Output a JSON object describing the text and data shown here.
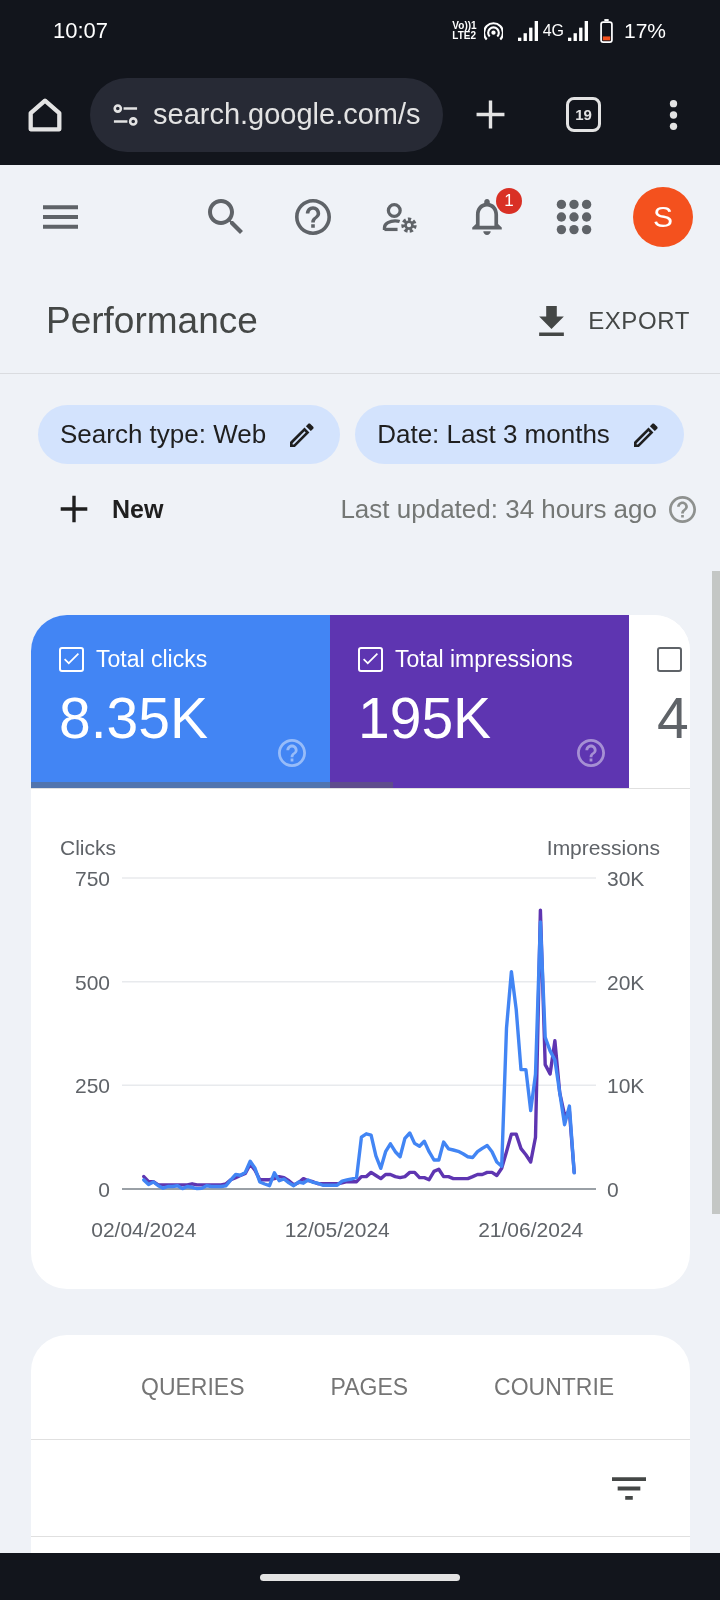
{
  "status_bar": {
    "time": "10:07",
    "volte_top": "Vo))1",
    "volte_bottom": "LTE2",
    "network": "4G",
    "battery": "17%"
  },
  "browser": {
    "url": "search.google.com/s",
    "tab_count": "19"
  },
  "header": {
    "notification_count": "1",
    "avatar_letter": "S"
  },
  "page_title": "Performance",
  "export_button": "EXPORT",
  "filters": [
    {
      "label": "Search type: Web"
    },
    {
      "label": "Date: Last 3 months"
    }
  ],
  "new_button": "New",
  "last_updated": "Last updated: 34 hours ago",
  "metrics": [
    {
      "label": "Total clicks",
      "value": "8.35K",
      "checked": true,
      "color": "#4285f4",
      "has_help": true
    },
    {
      "label": "Total impressions",
      "value": "195K",
      "checked": true,
      "color": "#5e35b1",
      "has_help": true
    },
    {
      "value": "4",
      "checked": false
    }
  ],
  "chart": {
    "chart_data": {
      "type": "line",
      "ylabel": "Clicks",
      "ylim": [
        0,
        750
      ],
      "yticks": [
        0,
        250,
        500,
        750
      ],
      "y2label": "Impressions",
      "y2lim": [
        0,
        30000
      ],
      "y2ticks": [
        {
          "value": 0,
          "label": "0"
        },
        {
          "value": 10000,
          "label": "10K"
        },
        {
          "value": 20000,
          "label": "20K"
        },
        {
          "value": 30000,
          "label": "30K"
        }
      ],
      "categories": [
        "02/04/2024",
        null,
        null,
        null,
        null,
        null,
        null,
        null,
        null,
        null,
        null,
        null,
        null,
        null,
        null,
        null,
        null,
        null,
        null,
        null,
        null,
        null,
        null,
        null,
        null,
        null,
        null,
        null,
        null,
        null,
        null,
        null,
        null,
        null,
        null,
        null,
        null,
        null,
        null,
        null,
        "12/05/2024",
        null,
        null,
        null,
        null,
        null,
        null,
        null,
        null,
        null,
        null,
        null,
        null,
        null,
        null,
        null,
        null,
        null,
        null,
        null,
        null,
        null,
        null,
        null,
        null,
        null,
        null,
        null,
        null,
        null,
        null,
        null,
        null,
        null,
        null,
        null,
        null,
        null,
        null,
        null,
        "21/06/2024",
        null,
        null,
        null,
        null,
        null,
        null,
        null,
        null,
        null
      ],
      "series": [
        {
          "color": "#4285f4",
          "values": [
            22,
            11,
            17,
            8,
            2,
            6,
            6,
            8,
            1,
            6,
            4,
            1,
            2,
            8,
            6,
            6,
            6,
            8,
            22,
            35,
            33,
            40,
            67,
            50,
            17,
            12,
            8,
            39,
            20,
            24,
            15,
            8,
            17,
            14,
            22,
            16,
            14,
            9,
            9,
            9,
            9,
            19,
            22,
            24,
            28,
            125,
            133,
            130,
            80,
            50,
            90,
            109,
            90,
            78,
            122,
            135,
            110,
            103,
            115,
            90,
            70,
            70,
            113,
            97,
            94,
            91,
            85,
            78,
            76,
            90,
            98,
            105,
            90,
            65,
            55,
            388,
            524,
            433,
            288,
            288,
            189,
            277,
            644,
            366,
            333,
            311,
            233,
            155,
            200,
            39
          ]
        },
        {
          "color": "#5e35b1",
          "axis": "y2",
          "values": [
            1200,
            700,
            700,
            400,
            400,
            400,
            400,
            400,
            400,
            400,
            500,
            400,
            400,
            400,
            400,
            400,
            400,
            500,
            900,
            1100,
            1300,
            1500,
            2400,
            1800,
            900,
            900,
            900,
            1000,
            1200,
            1100,
            800,
            400,
            600,
            1000,
            800,
            700,
            500,
            500,
            500,
            500,
            500,
            600,
            700,
            700,
            700,
            1200,
            1200,
            1600,
            1300,
            1000,
            1400,
            1400,
            1200,
            1100,
            1200,
            1600,
            1600,
            1100,
            1100,
            900,
            1700,
            1900,
            1200,
            1200,
            1000,
            1000,
            1000,
            1000,
            1200,
            1400,
            1400,
            1600,
            1600,
            1300,
            2000,
            3600,
            5300,
            5300,
            3900,
            3300,
            2600,
            5000,
            26900,
            12000,
            11100,
            14300,
            9300,
            7100,
            7500,
            1600
          ]
        }
      ]
    }
  },
  "tabs": [
    {
      "label": "QUERIES",
      "selected": false
    },
    {
      "label": "PAGES",
      "selected": false
    },
    {
      "label": "COUNTRIE",
      "selected": false
    }
  ]
}
